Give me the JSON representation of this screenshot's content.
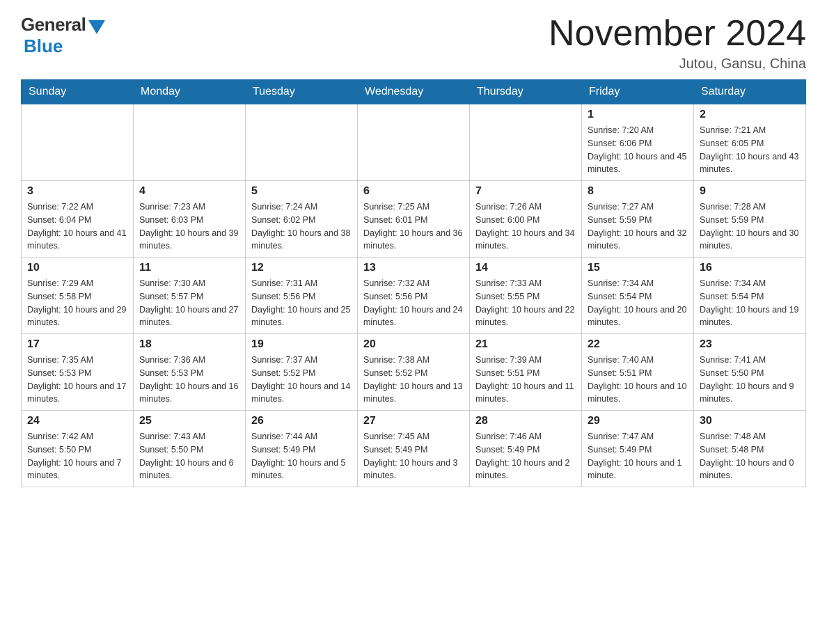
{
  "logo": {
    "general": "General",
    "blue": "Blue"
  },
  "title": "November 2024",
  "location": "Jutou, Gansu, China",
  "days_of_week": [
    "Sunday",
    "Monday",
    "Tuesday",
    "Wednesday",
    "Thursday",
    "Friday",
    "Saturday"
  ],
  "weeks": [
    [
      {
        "day": "",
        "info": ""
      },
      {
        "day": "",
        "info": ""
      },
      {
        "day": "",
        "info": ""
      },
      {
        "day": "",
        "info": ""
      },
      {
        "day": "",
        "info": ""
      },
      {
        "day": "1",
        "info": "Sunrise: 7:20 AM\nSunset: 6:06 PM\nDaylight: 10 hours and 45 minutes."
      },
      {
        "day": "2",
        "info": "Sunrise: 7:21 AM\nSunset: 6:05 PM\nDaylight: 10 hours and 43 minutes."
      }
    ],
    [
      {
        "day": "3",
        "info": "Sunrise: 7:22 AM\nSunset: 6:04 PM\nDaylight: 10 hours and 41 minutes."
      },
      {
        "day": "4",
        "info": "Sunrise: 7:23 AM\nSunset: 6:03 PM\nDaylight: 10 hours and 39 minutes."
      },
      {
        "day": "5",
        "info": "Sunrise: 7:24 AM\nSunset: 6:02 PM\nDaylight: 10 hours and 38 minutes."
      },
      {
        "day": "6",
        "info": "Sunrise: 7:25 AM\nSunset: 6:01 PM\nDaylight: 10 hours and 36 minutes."
      },
      {
        "day": "7",
        "info": "Sunrise: 7:26 AM\nSunset: 6:00 PM\nDaylight: 10 hours and 34 minutes."
      },
      {
        "day": "8",
        "info": "Sunrise: 7:27 AM\nSunset: 5:59 PM\nDaylight: 10 hours and 32 minutes."
      },
      {
        "day": "9",
        "info": "Sunrise: 7:28 AM\nSunset: 5:59 PM\nDaylight: 10 hours and 30 minutes."
      }
    ],
    [
      {
        "day": "10",
        "info": "Sunrise: 7:29 AM\nSunset: 5:58 PM\nDaylight: 10 hours and 29 minutes."
      },
      {
        "day": "11",
        "info": "Sunrise: 7:30 AM\nSunset: 5:57 PM\nDaylight: 10 hours and 27 minutes."
      },
      {
        "day": "12",
        "info": "Sunrise: 7:31 AM\nSunset: 5:56 PM\nDaylight: 10 hours and 25 minutes."
      },
      {
        "day": "13",
        "info": "Sunrise: 7:32 AM\nSunset: 5:56 PM\nDaylight: 10 hours and 24 minutes."
      },
      {
        "day": "14",
        "info": "Sunrise: 7:33 AM\nSunset: 5:55 PM\nDaylight: 10 hours and 22 minutes."
      },
      {
        "day": "15",
        "info": "Sunrise: 7:34 AM\nSunset: 5:54 PM\nDaylight: 10 hours and 20 minutes."
      },
      {
        "day": "16",
        "info": "Sunrise: 7:34 AM\nSunset: 5:54 PM\nDaylight: 10 hours and 19 minutes."
      }
    ],
    [
      {
        "day": "17",
        "info": "Sunrise: 7:35 AM\nSunset: 5:53 PM\nDaylight: 10 hours and 17 minutes."
      },
      {
        "day": "18",
        "info": "Sunrise: 7:36 AM\nSunset: 5:53 PM\nDaylight: 10 hours and 16 minutes."
      },
      {
        "day": "19",
        "info": "Sunrise: 7:37 AM\nSunset: 5:52 PM\nDaylight: 10 hours and 14 minutes."
      },
      {
        "day": "20",
        "info": "Sunrise: 7:38 AM\nSunset: 5:52 PM\nDaylight: 10 hours and 13 minutes."
      },
      {
        "day": "21",
        "info": "Sunrise: 7:39 AM\nSunset: 5:51 PM\nDaylight: 10 hours and 11 minutes."
      },
      {
        "day": "22",
        "info": "Sunrise: 7:40 AM\nSunset: 5:51 PM\nDaylight: 10 hours and 10 minutes."
      },
      {
        "day": "23",
        "info": "Sunrise: 7:41 AM\nSunset: 5:50 PM\nDaylight: 10 hours and 9 minutes."
      }
    ],
    [
      {
        "day": "24",
        "info": "Sunrise: 7:42 AM\nSunset: 5:50 PM\nDaylight: 10 hours and 7 minutes."
      },
      {
        "day": "25",
        "info": "Sunrise: 7:43 AM\nSunset: 5:50 PM\nDaylight: 10 hours and 6 minutes."
      },
      {
        "day": "26",
        "info": "Sunrise: 7:44 AM\nSunset: 5:49 PM\nDaylight: 10 hours and 5 minutes."
      },
      {
        "day": "27",
        "info": "Sunrise: 7:45 AM\nSunset: 5:49 PM\nDaylight: 10 hours and 3 minutes."
      },
      {
        "day": "28",
        "info": "Sunrise: 7:46 AM\nSunset: 5:49 PM\nDaylight: 10 hours and 2 minutes."
      },
      {
        "day": "29",
        "info": "Sunrise: 7:47 AM\nSunset: 5:49 PM\nDaylight: 10 hours and 1 minute."
      },
      {
        "day": "30",
        "info": "Sunrise: 7:48 AM\nSunset: 5:48 PM\nDaylight: 10 hours and 0 minutes."
      }
    ]
  ]
}
